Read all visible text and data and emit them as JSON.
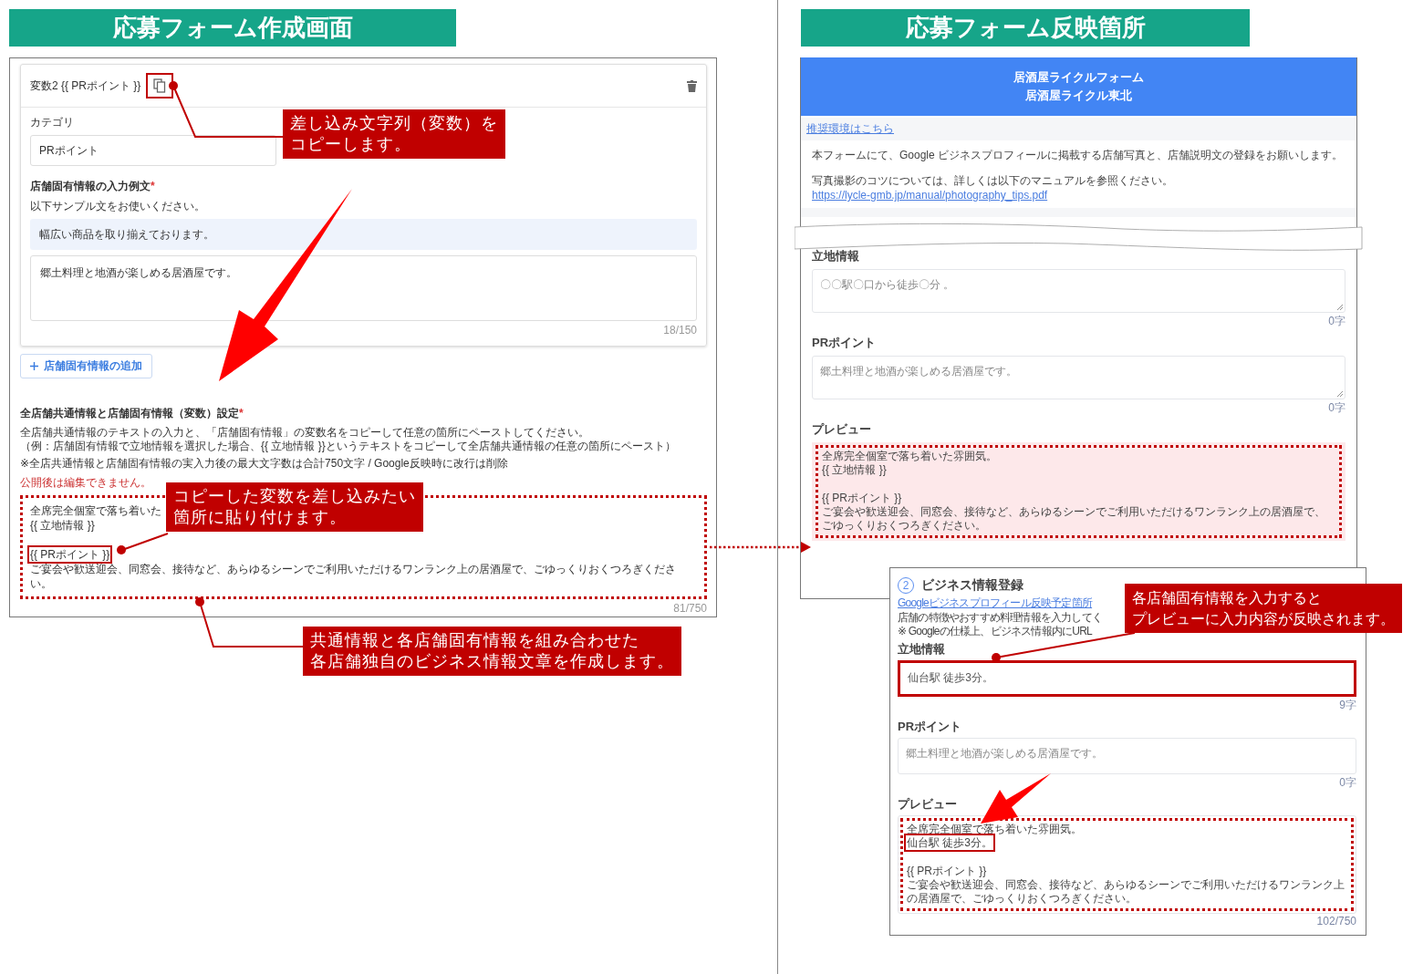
{
  "left_heading": "応募フォーム作成画面",
  "right_heading": "応募フォーム反映箇所",
  "editor": {
    "variable_label": "変数2 {{ PRポイント }}",
    "copy_highlighted": true,
    "category_label": "カテゴリ",
    "category_value": "PRポイント",
    "example_label": "店舗固有情報の入力例文",
    "example_required_mark": "*",
    "example_hint": "以下サンプル文をお使いください。",
    "sample": "幅広い商品を取り揃えております。",
    "example_value": "郷土料理と地酒が楽しめる居酒屋です。",
    "example_count": "18/150",
    "add_button": "店舗固有情報の追加",
    "settings_label": "全店舗共通情報と店舗固有情報（変数）設定",
    "settings_required_mark": "*",
    "settings_desc": [
      "全店舗共通情報のテキストの入力と、「店舗固有情報」の変数名をコピーして任意の箇所にペーストしてください。",
      "（例：店舗固有情報で立地情報を選択した場合、{{ 立地情報 }}というテキストをコピーして全店舗共通情報の任意の箇所にペースト）"
    ],
    "settings_note": "※全店共通情報と店舗固有情報の実入力後の最大文字数は合計750文字 / Google反映時に改行は削除",
    "warning": "公開後は編集できません。",
    "template_annotated": true,
    "template_paragraphs": [
      [
        {
          "text": "全席完全個室で落ち着いた",
          "highlighted": false
        },
        {
          "text": "{{ 立地情報 }}",
          "highlighted": false
        }
      ],
      [
        {
          "text": "{{ PRポイント }}",
          "highlighted": true
        },
        {
          "text": "ご宴会や歓送迎会、同窓会、接待など、あらゆるシーンでご利用いただけるワンランク上の居酒屋で、ごゆっくりおくつろぎください。",
          "highlighted": false
        }
      ]
    ],
    "template_count": "81/750"
  },
  "form": {
    "header": [
      "居酒屋ライクルフォーム",
      "居酒屋ライクル東北"
    ],
    "env_link": "推奨環境はこちら",
    "intro": "本フォームにて、Google ビジネスプロフィールに掲載する店舗写真と、店舗説明文の登録をお願いします。",
    "photo_note": "写真撮影のコツについては、詳しくは以下のマニュアルを参照ください。",
    "manual_link": "https://lycle-gmb.jp/manual/photography_tips.pdf",
    "fields": [
      {
        "label": "立地情報",
        "placeholder": "〇〇駅〇口から徒歩〇分 。",
        "count": "0字"
      },
      {
        "label": "PRポイント",
        "placeholder": "郷土料理と地酒が楽しめる居酒屋です。",
        "count": "0字"
      }
    ],
    "preview_label": "プレビュー",
    "preview_annotated": true,
    "preview_paragraphs": [
      [
        {
          "text": "全席完全個室で落ち着いた雰囲気。",
          "highlighted": false
        },
        {
          "text": "{{ 立地情報 }}",
          "highlighted": false
        }
      ],
      [
        {
          "text": "{{ PRポイント }}",
          "highlighted": false
        },
        {
          "text": "ご宴会や歓送迎会、同窓会、接待など、あらゆるシーンでご利用いただけるワンランク上の居酒屋で、ごゆっくりおくつろぎください。",
          "highlighted": false
        }
      ]
    ]
  },
  "form_step": {
    "step": "2",
    "title": "ビジネス情報登録",
    "link": "Googleビジネスプロフィール反映予定箇所",
    "desc": [
      "店舗の特徴やおすすめ料理情報を入力してく",
      "※ Googleの仕様上、ビジネス情報内にURL"
    ],
    "fields": [
      {
        "label": "立地情報",
        "value": "仙台駅 徒歩3分。",
        "count": "9字",
        "highlighted": true
      },
      {
        "label": "PRポイント",
        "placeholder": "郷土料理と地酒が楽しめる居酒屋です。",
        "count": "0字",
        "highlighted": false
      }
    ],
    "preview_label": "プレビュー",
    "preview_annotated": true,
    "preview_paragraphs": [
      [
        {
          "text": "全席完全個室で落ち着いた雰囲気。",
          "highlighted": false
        },
        {
          "text": "仙台駅 徒歩3分。",
          "highlighted": true
        }
      ],
      [
        {
          "text": "{{ PRポイント }}",
          "highlighted": false
        },
        {
          "text": "ご宴会や歓送迎会、同窓会、接待など、あらゆるシーンでご利用いただけるワンランク上の居酒屋で、ごゆっくりおくつろぎください。",
          "highlighted": false
        }
      ]
    ],
    "preview_count": "102/750"
  },
  "callouts": {
    "copy_note": [
      "差し込み文字列（変数）を",
      "コピーします。"
    ],
    "paste_note": [
      "コピーした変数を差し込みたい",
      "箇所に貼り付けます。"
    ],
    "combine_note": [
      "共通情報と各店舗固有情報を組み合わせた",
      "各店舗独自のビジネス情報文章を作成します。"
    ],
    "reflect_note": [
      "各店舗固有情報を入力すると",
      "プレビューに入力内容が反映されます。"
    ]
  }
}
